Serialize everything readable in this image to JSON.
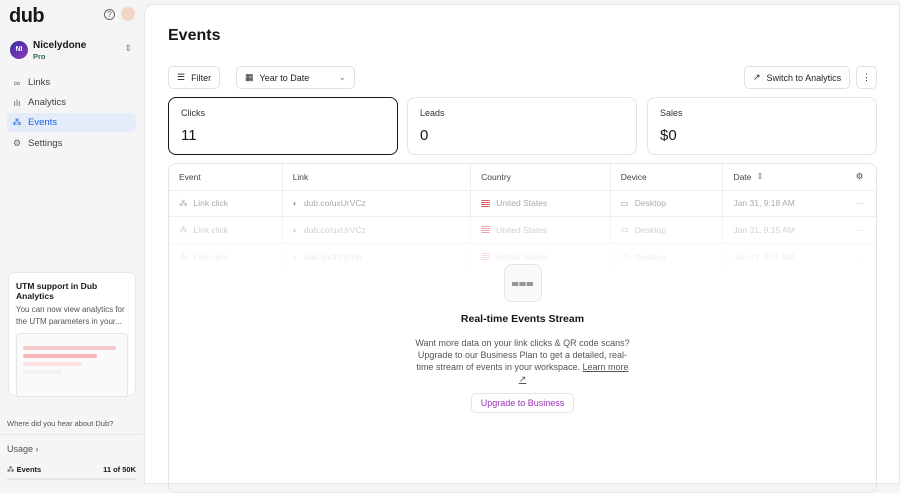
{
  "app": {
    "logo": "dub",
    "help_icon": "?"
  },
  "workspace": {
    "initials": "NI",
    "name": "Nicelydone",
    "plan": "Pro"
  },
  "nav": [
    {
      "label": "Links",
      "icon": "link-icon",
      "glyph": "∞"
    },
    {
      "label": "Analytics",
      "icon": "chart-icon",
      "glyph": "ılı"
    },
    {
      "label": "Events",
      "icon": "cursor-rays-icon",
      "glyph": "⁂"
    },
    {
      "label": "Settings",
      "icon": "gear-icon",
      "glyph": "⚙"
    }
  ],
  "promo": {
    "title": "UTM support in Dub Analytics",
    "text": "You can now view analytics for the UTM parameters in your..."
  },
  "hear": "Where did you hear about Dub?",
  "usage": {
    "label": "Usage ›",
    "events_label": "Events",
    "events_value": "11 of 50K",
    "fraction": 0.00022
  },
  "page": {
    "title": "Events",
    "filter": "Filter",
    "date_range": "Year to Date",
    "switch": "Switch to Analytics"
  },
  "stats": [
    {
      "label": "Clicks",
      "value": "11"
    },
    {
      "label": "Leads",
      "value": "0"
    },
    {
      "label": "Sales",
      "value": "$0"
    }
  ],
  "table": {
    "headers": [
      "Event",
      "Link",
      "Country",
      "Device",
      "Date"
    ],
    "rows": [
      {
        "event": "Link click",
        "link": "dub.co/uxUrVCz",
        "country": "United States",
        "device": "Desktop",
        "date": "Jan 31, 9:18 AM"
      },
      {
        "event": "Link click",
        "link": "dub.co/uxUrVCz",
        "country": "United States",
        "device": "Desktop",
        "date": "Jan 31, 9:15 AM"
      },
      {
        "event": "Link click",
        "link": "dub.sh/9YoPhn",
        "country": "United States",
        "device": "Desktop",
        "date": "Jan 31, 9:11 AM"
      }
    ]
  },
  "upsell": {
    "title": "Real-time Events Stream",
    "desc": "Want more data on your link clicks & QR code scans? Upgrade to our Business Plan to get a detailed, real-time stream of events in your workspace.",
    "learn": "Learn more ↗",
    "button": "Upgrade to Business"
  },
  "colors": {
    "accent": "#2563eb",
    "upgrade": "#9d2fb8"
  }
}
